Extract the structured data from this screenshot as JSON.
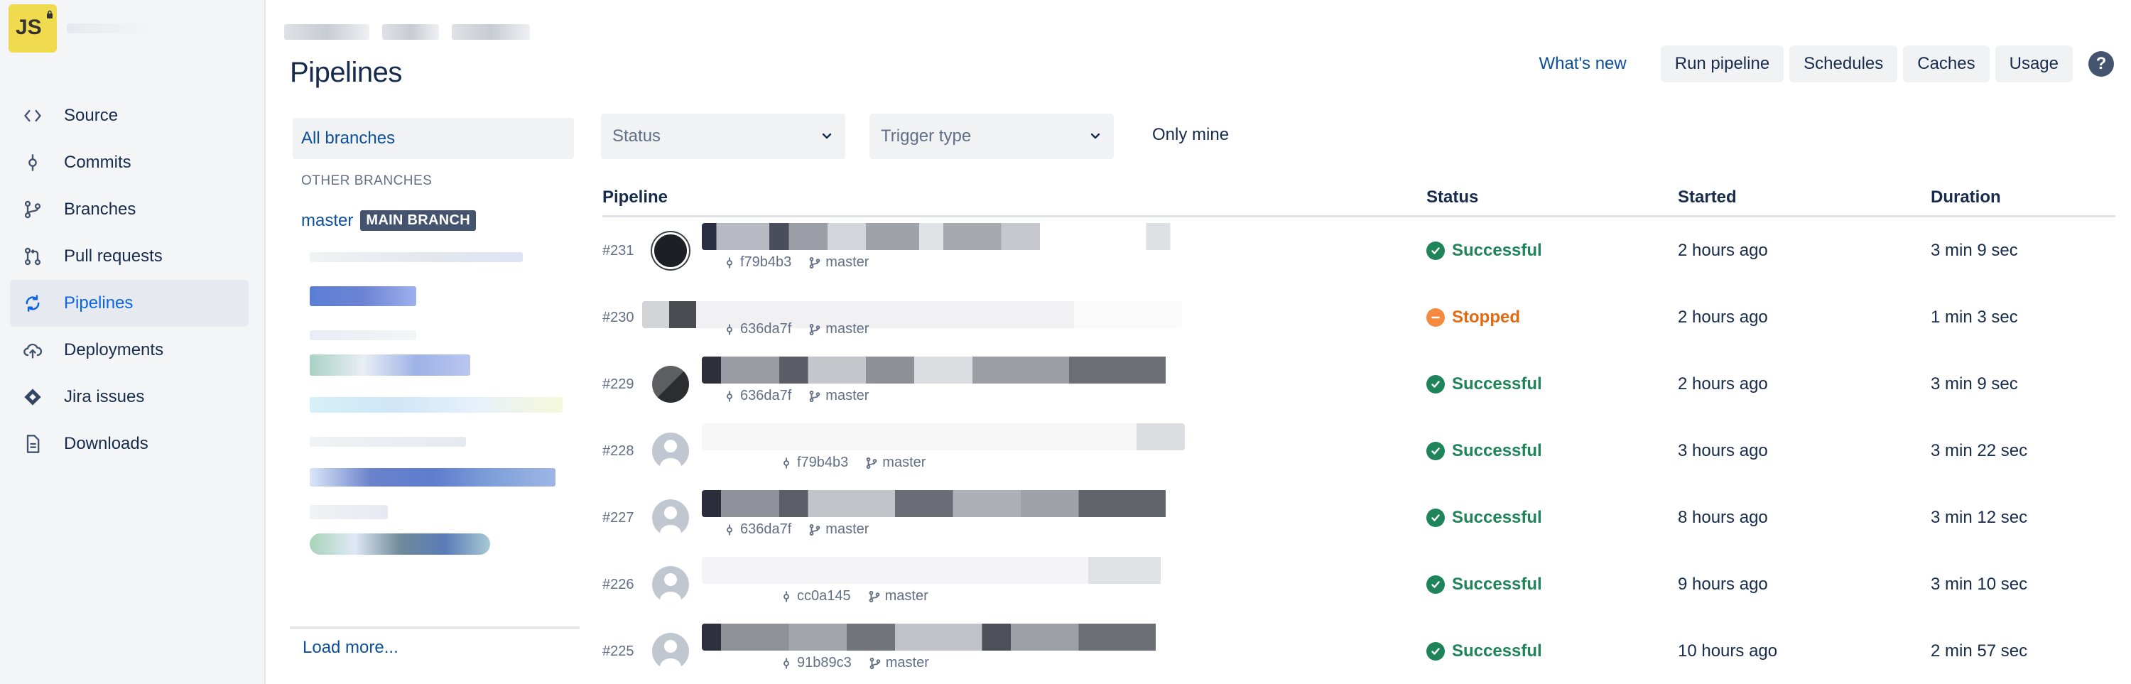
{
  "repo": {
    "avatar_text": "JS"
  },
  "nav": [
    {
      "label": "Source",
      "icon": "code-icon"
    },
    {
      "label": "Commits",
      "icon": "commit-icon"
    },
    {
      "label": "Branches",
      "icon": "branch-icon"
    },
    {
      "label": "Pull requests",
      "icon": "pull-request-icon"
    },
    {
      "label": "Pipelines",
      "icon": "pipelines-icon",
      "active": true
    },
    {
      "label": "Deployments",
      "icon": "cloud-upload-icon"
    },
    {
      "label": "Jira issues",
      "icon": "jira-icon"
    },
    {
      "label": "Downloads",
      "icon": "document-icon"
    }
  ],
  "header": {
    "title": "Pipelines",
    "whats_new": "What's new",
    "buttons": {
      "run": "Run pipeline",
      "schedules": "Schedules",
      "caches": "Caches",
      "usage": "Usage"
    },
    "help": "?"
  },
  "branches": {
    "all": "All branches",
    "other_heading": "OTHER BRANCHES",
    "master": "master",
    "main_badge": "MAIN BRANCH",
    "load_more": "Load more..."
  },
  "filters": {
    "status_placeholder": "Status",
    "trigger_placeholder": "Trigger type",
    "only_mine": "Only mine"
  },
  "table": {
    "headers": {
      "pipeline": "Pipeline",
      "status": "Status",
      "started": "Started",
      "duration": "Duration"
    },
    "rows": [
      {
        "number": "#231",
        "hash": "f79b4b3",
        "branch": "master",
        "status": "Successful",
        "status_kind": "success",
        "started": "2 hours ago",
        "duration": "3 min 9 sec"
      },
      {
        "number": "#230",
        "hash": "636da7f",
        "branch": "master",
        "status": "Stopped",
        "status_kind": "stopped",
        "started": "2 hours ago",
        "duration": "1 min 3 sec"
      },
      {
        "number": "#229",
        "hash": "636da7f",
        "branch": "master",
        "status": "Successful",
        "status_kind": "success",
        "started": "2 hours ago",
        "duration": "3 min 9 sec"
      },
      {
        "number": "#228",
        "hash": "f79b4b3",
        "branch": "master",
        "status": "Successful",
        "status_kind": "success",
        "started": "3 hours ago",
        "duration": "3 min 22 sec"
      },
      {
        "number": "#227",
        "hash": "636da7f",
        "branch": "master",
        "status": "Successful",
        "status_kind": "success",
        "started": "8 hours ago",
        "duration": "3 min 12 sec"
      },
      {
        "number": "#226",
        "hash": "cc0a145",
        "branch": "master",
        "status": "Successful",
        "status_kind": "success",
        "started": "9 hours ago",
        "duration": "3 min 10 sec"
      },
      {
        "number": "#225",
        "hash": "91b89c3",
        "branch": "master",
        "status": "Successful",
        "status_kind": "success",
        "started": "10 hours ago",
        "duration": "2 min 57 sec"
      }
    ]
  },
  "colors": {
    "success": "#1f845a",
    "stopped": "#e56910",
    "link": "#0c4f9c",
    "avatar_bg": "#f0db4f"
  }
}
